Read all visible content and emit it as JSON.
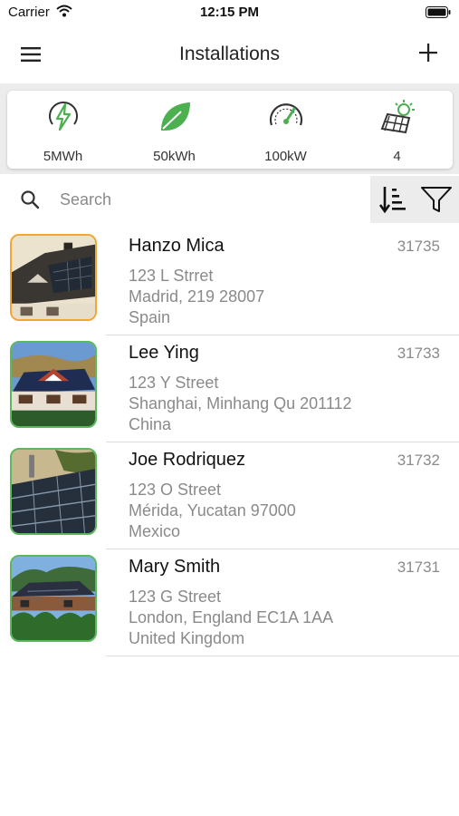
{
  "status_bar": {
    "carrier": "Carrier",
    "time": "12:15 PM"
  },
  "nav": {
    "title": "Installations",
    "menu_icon": "hamburger-menu-icon",
    "add_icon": "plus-icon"
  },
  "stats": [
    {
      "icon": "energy-bolt-icon",
      "value": "5MWh"
    },
    {
      "icon": "leaf-icon",
      "value": "50kWh"
    },
    {
      "icon": "gauge-icon",
      "value": "100kW"
    },
    {
      "icon": "solar-panel-sun-icon",
      "value": "4"
    }
  ],
  "search": {
    "placeholder": "Search",
    "value": "",
    "sort_icon": "sort-descending-icon",
    "filter_icon": "filter-icon"
  },
  "colors": {
    "accent_green": "#4caf50",
    "selected_border": "#f0a830",
    "secondary_text": "#8a8a8a"
  },
  "installations": [
    {
      "name": "Hanzo Mica",
      "code": "31735",
      "street": "123 L Strret",
      "city": "Madrid, 219 28007",
      "country": "Spain",
      "selected": true
    },
    {
      "name": "Lee Ying",
      "code": "31733",
      "street": "123 Y Street",
      "city": "Shanghai, Minhang Qu 201112",
      "country": "China",
      "selected": false
    },
    {
      "name": "Joe Rodriquez",
      "code": "31732",
      "street": "123 O Street",
      "city": "Mérida, Yucatan 97000",
      "country": "Mexico",
      "selected": false
    },
    {
      "name": "Mary Smith",
      "code": "31731",
      "street": "123 G Street",
      "city": "London, England EC1A 1AA",
      "country": "United Kingdom",
      "selected": false
    }
  ]
}
